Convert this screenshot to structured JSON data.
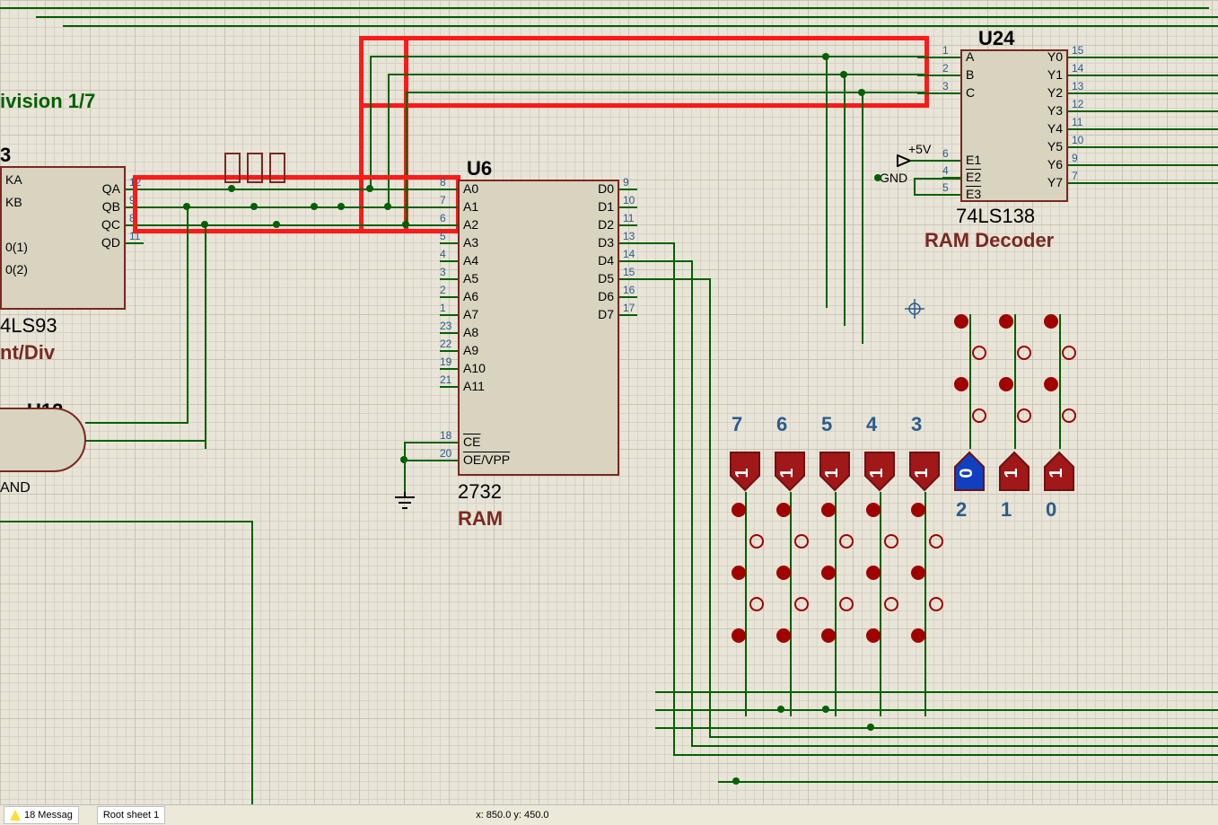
{
  "title_fragment": "ivision 1/7",
  "status": {
    "messages": "18 Messag",
    "sheet": "Root sheet 1",
    "coords": "x:     850.0   y:     450.0"
  },
  "power": {
    "vcc": "+5V",
    "gnd": "GND"
  },
  "u3": {
    "ref": "3",
    "part": "4LS93",
    "caption": "nt/Div",
    "left_pins": [
      {
        "n": "",
        "l": "KA"
      },
      {
        "n": "",
        "l": "KB"
      },
      {
        "n": "",
        "l": ""
      },
      {
        "n": "",
        "l": "0(1)"
      },
      {
        "n": "",
        "l": "0(2)"
      }
    ],
    "right_pins": [
      {
        "n": "12",
        "l": "QA"
      },
      {
        "n": "9",
        "l": "QB"
      },
      {
        "n": "8",
        "l": "QC"
      },
      {
        "n": "11",
        "l": "QD"
      }
    ]
  },
  "u12": {
    "ref": "U12",
    "caption": "AND"
  },
  "u6": {
    "ref": "U6",
    "part": "2732",
    "caption": "RAM",
    "left_pins": [
      {
        "n": "8",
        "l": "A0"
      },
      {
        "n": "7",
        "l": "A1"
      },
      {
        "n": "6",
        "l": "A2"
      },
      {
        "n": "5",
        "l": "A3"
      },
      {
        "n": "4",
        "l": "A4"
      },
      {
        "n": "3",
        "l": "A5"
      },
      {
        "n": "2",
        "l": "A6"
      },
      {
        "n": "1",
        "l": "A7"
      },
      {
        "n": "23",
        "l": "A8"
      },
      {
        "n": "22",
        "l": "A9"
      },
      {
        "n": "19",
        "l": "A10"
      },
      {
        "n": "21",
        "l": "A11"
      }
    ],
    "ctrl_pins": [
      {
        "n": "18",
        "l": "CE",
        "bar": true
      },
      {
        "n": "20",
        "l": "OE/VPP",
        "bar": true
      }
    ],
    "right_pins": [
      {
        "n": "9",
        "l": "D0"
      },
      {
        "n": "10",
        "l": "D1"
      },
      {
        "n": "11",
        "l": "D2"
      },
      {
        "n": "13",
        "l": "D3"
      },
      {
        "n": "14",
        "l": "D4"
      },
      {
        "n": "15",
        "l": "D5"
      },
      {
        "n": "16",
        "l": "D6"
      },
      {
        "n": "17",
        "l": "D7"
      }
    ]
  },
  "u24": {
    "ref": "U24",
    "part": "74LS138",
    "caption": "RAM Decoder",
    "left_pins": [
      {
        "n": "1",
        "l": "A"
      },
      {
        "n": "2",
        "l": "B"
      },
      {
        "n": "3",
        "l": "C"
      }
    ],
    "en_pins": [
      {
        "n": "6",
        "l": "E1"
      },
      {
        "n": "4",
        "l": "E2",
        "bar": true
      },
      {
        "n": "5",
        "l": "E3",
        "bar": true
      }
    ],
    "right_pins": [
      {
        "n": "15",
        "l": "Y0"
      },
      {
        "n": "14",
        "l": "Y1"
      },
      {
        "n": "13",
        "l": "Y2"
      },
      {
        "n": "12",
        "l": "Y3"
      },
      {
        "n": "11",
        "l": "Y4"
      },
      {
        "n": "10",
        "l": "Y5"
      },
      {
        "n": "9",
        "l": "Y6"
      },
      {
        "n": "7",
        "l": "Y7"
      }
    ]
  },
  "logic_states": {
    "labels": [
      "7",
      "6",
      "5",
      "4",
      "3",
      "2",
      "1",
      "0"
    ],
    "values": [
      "1",
      "1",
      "1",
      "1",
      "1",
      "0",
      "1",
      "1"
    ]
  }
}
